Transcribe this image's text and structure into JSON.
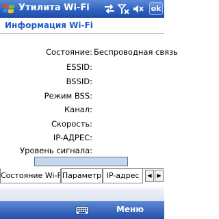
{
  "titlebar": {
    "title": "Утилита Wi-Fi",
    "ok_label": "ok",
    "icons": [
      "windows-start-icon",
      "connectivity-icon",
      "no-signal-icon",
      "volume-mute-icon"
    ]
  },
  "header": {
    "title": "Информация Wi-Fi"
  },
  "info": {
    "rows": [
      {
        "label": "Состояние:",
        "value": "Беспроводная связь"
      },
      {
        "label": "ESSID:",
        "value": ""
      },
      {
        "label": "BSSID:",
        "value": ""
      },
      {
        "label": "Режим BSS:",
        "value": ""
      },
      {
        "label": "Канал:",
        "value": ""
      },
      {
        "label": "Скорость:",
        "value": ""
      },
      {
        "label": "IP-АДРЕС:",
        "value": ""
      },
      {
        "label": "Уровень сигнала:",
        "value": ""
      }
    ],
    "signal_level": 0
  },
  "tabs": [
    {
      "label": "Состояние Wi-Fi",
      "active": true
    },
    {
      "label": "Параметр",
      "active": false
    },
    {
      "label": "IP-адрес",
      "active": false
    }
  ],
  "menubar": {
    "menu_label": "Меню"
  },
  "colors": {
    "titlebar": "#2f62c0",
    "header_text": "#1f5bc4",
    "signal_bar": "#c6d6ec"
  }
}
